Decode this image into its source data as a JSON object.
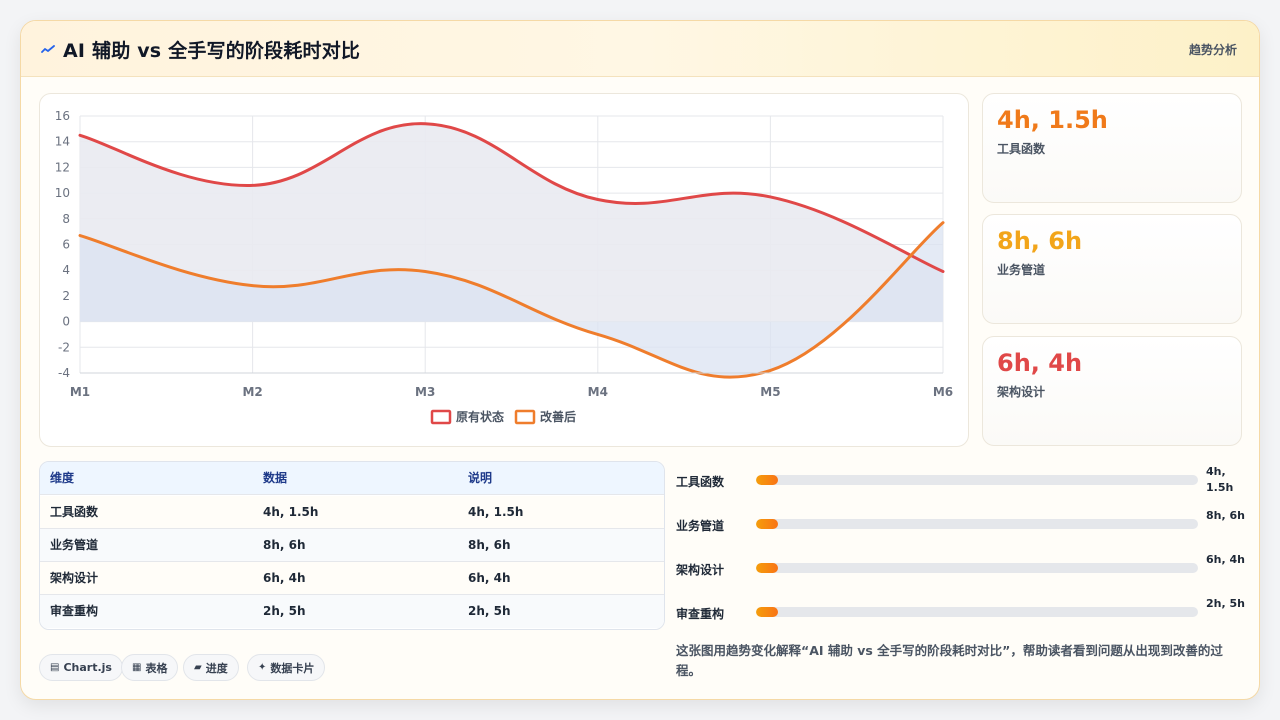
{
  "header": {
    "icon": "wave-icon",
    "title": "AI 辅助 vs 全手写的阶段耗时对比",
    "action_label": "趋势分析"
  },
  "chart_data": {
    "type": "line",
    "categories": [
      "M1",
      "M2",
      "M3",
      "M4",
      "M5",
      "M6"
    ],
    "ylim": [
      -4,
      16
    ],
    "yticks": [
      16,
      14,
      12,
      10,
      8,
      6,
      4,
      2,
      0,
      -2,
      -4
    ],
    "grid": true,
    "legend_position": "bottom",
    "series": [
      {
        "name": "原有状态",
        "values": [
          14.5,
          10.6,
          15.4,
          9.5,
          9.7,
          3.9
        ],
        "color": "#e04848",
        "fill": "#e9eaf1"
      },
      {
        "name": "改善后",
        "values": [
          6.7,
          2.8,
          3.9,
          -1.0,
          -3.8,
          7.7
        ],
        "color": "#ef7d2c",
        "fill": "#dbe3f2"
      }
    ]
  },
  "stats": [
    {
      "value": "4h, 1.5h",
      "label": "工具函数",
      "color": "#f07a1a"
    },
    {
      "value": "8h, 6h",
      "label": "业务管道",
      "color": "#f2a51a"
    },
    {
      "value": "6h, 4h",
      "label": "架构设计",
      "color": "#e04848"
    }
  ],
  "table": {
    "headers": [
      "维度",
      "数据",
      "说明"
    ],
    "rows": [
      [
        "工具函数",
        "4h, 1.5h",
        "4h, 1.5h"
      ],
      [
        "业务管道",
        "8h, 6h",
        "8h, 6h"
      ],
      [
        "架构设计",
        "6h, 4h",
        "6h, 4h"
      ],
      [
        "审查重构",
        "2h, 5h",
        "2h, 5h"
      ]
    ]
  },
  "progress": [
    {
      "label": "工具函数",
      "value": "4h, 1.5h",
      "fraction": 0.05
    },
    {
      "label": "业务管道",
      "value": "8h, 6h",
      "fraction": 0.05
    },
    {
      "label": "架构设计",
      "value": "6h, 4h",
      "fraction": 0.05
    },
    {
      "label": "审查重构",
      "value": "2h, 5h",
      "fraction": 0.05
    }
  ],
  "chips": [
    {
      "icon": "▤",
      "label": "Chart.js"
    },
    {
      "icon": "▦",
      "label": "表格"
    },
    {
      "icon": "▰",
      "label": "进度"
    },
    {
      "icon": "✦",
      "label": "数据卡片"
    }
  ],
  "description": "这张图用趋势变化解释“AI 辅助 vs 全手写的阶段耗时对比”，帮助读者看到问题从出现到改善的过程。"
}
